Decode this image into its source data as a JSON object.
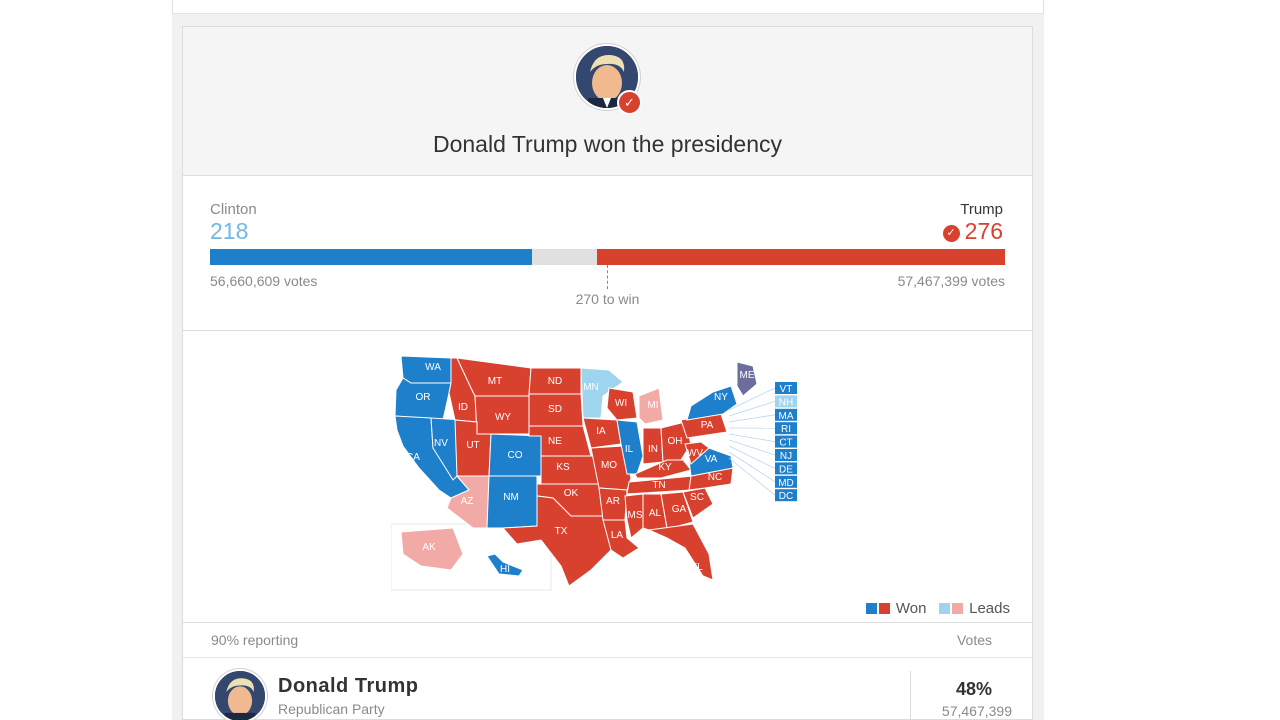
{
  "hero": {
    "title": "Donald Trump won the presidency",
    "check_icon": "check-icon"
  },
  "results": {
    "left": {
      "name": "Clinton",
      "electoral_votes": "218",
      "popular_votes": "56,660,609 votes",
      "color": "#1e7fcb"
    },
    "right": {
      "name": "Trump",
      "electoral_votes": "276",
      "popular_votes": "57,467,399 votes",
      "color": "#d9412f"
    },
    "threshold_label": "270 to win",
    "total_electoral_votes": 538
  },
  "map": {
    "colors": {
      "dem_won": "#1e7fcb",
      "dem_leads": "#9fd4ee",
      "rep_won": "#d9412f",
      "rep_leads": "#f2aaa6",
      "split": "#6b6e9c"
    },
    "states": [
      {
        "label": "WA",
        "status": "dem_won"
      },
      {
        "label": "OR",
        "status": "dem_won"
      },
      {
        "label": "CA",
        "status": "dem_won"
      },
      {
        "label": "NV",
        "status": "dem_won"
      },
      {
        "label": "ID",
        "status": "rep_won"
      },
      {
        "label": "MT",
        "status": "rep_won"
      },
      {
        "label": "WY",
        "status": "rep_won"
      },
      {
        "label": "UT",
        "status": "rep_won"
      },
      {
        "label": "CO",
        "status": "dem_won"
      },
      {
        "label": "AZ",
        "status": "rep_leads"
      },
      {
        "label": "NM",
        "status": "dem_won"
      },
      {
        "label": "ND",
        "status": "rep_won"
      },
      {
        "label": "SD",
        "status": "rep_won"
      },
      {
        "label": "NE",
        "status": "rep_won"
      },
      {
        "label": "KS",
        "status": "rep_won"
      },
      {
        "label": "OK",
        "status": "rep_won"
      },
      {
        "label": "TX",
        "status": "rep_won"
      },
      {
        "label": "MN",
        "status": "dem_leads"
      },
      {
        "label": "IA",
        "status": "rep_won"
      },
      {
        "label": "MO",
        "status": "rep_won"
      },
      {
        "label": "AR",
        "status": "rep_won"
      },
      {
        "label": "LA",
        "status": "rep_won"
      },
      {
        "label": "WI",
        "status": "rep_won"
      },
      {
        "label": "IL",
        "status": "dem_won"
      },
      {
        "label": "MI",
        "status": "rep_leads"
      },
      {
        "label": "IN",
        "status": "rep_won"
      },
      {
        "label": "OH",
        "status": "rep_won"
      },
      {
        "label": "KY",
        "status": "rep_won"
      },
      {
        "label": "TN",
        "status": "rep_won"
      },
      {
        "label": "MS",
        "status": "rep_won"
      },
      {
        "label": "AL",
        "status": "rep_won"
      },
      {
        "label": "GA",
        "status": "rep_won"
      },
      {
        "label": "FL",
        "status": "rep_won"
      },
      {
        "label": "SC",
        "status": "rep_won"
      },
      {
        "label": "NC",
        "status": "rep_won"
      },
      {
        "label": "VA",
        "status": "dem_won"
      },
      {
        "label": "WV",
        "status": "rep_won"
      },
      {
        "label": "PA",
        "status": "rep_won"
      },
      {
        "label": "NY",
        "status": "dem_won"
      },
      {
        "label": "ME",
        "status": "split"
      },
      {
        "label": "AK",
        "status": "rep_leads"
      },
      {
        "label": "HI",
        "status": "dem_won"
      }
    ],
    "small_states": [
      {
        "label": "VT",
        "status": "dem_won"
      },
      {
        "label": "NH",
        "status": "dem_leads"
      },
      {
        "label": "MA",
        "status": "dem_won"
      },
      {
        "label": "RI",
        "status": "dem_won"
      },
      {
        "label": "CT",
        "status": "dem_won"
      },
      {
        "label": "NJ",
        "status": "dem_won"
      },
      {
        "label": "DE",
        "status": "dem_won"
      },
      {
        "label": "MD",
        "status": "dem_won"
      },
      {
        "label": "DC",
        "status": "dem_won"
      }
    ],
    "legend": {
      "won": "Won",
      "leads": "Leads"
    }
  },
  "table": {
    "reporting": "90% reporting",
    "votes_header": "Votes",
    "rows": [
      {
        "name": "Donald Trump",
        "party": "Republican Party",
        "percent": "48%",
        "votes": "57,467,399"
      }
    ]
  }
}
